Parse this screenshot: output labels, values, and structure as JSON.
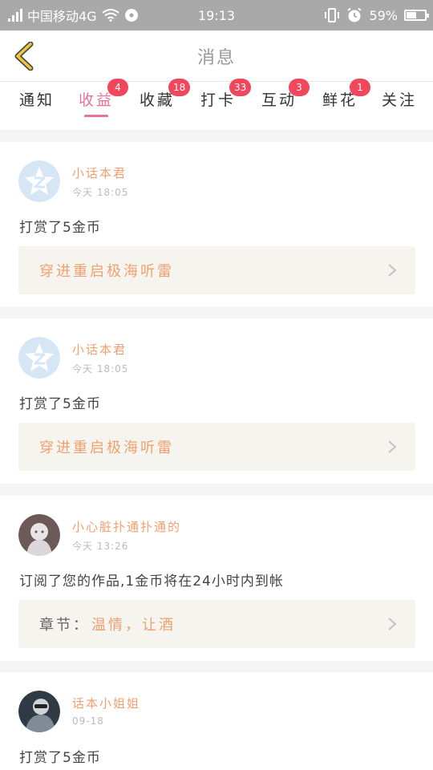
{
  "status_bar": {
    "carrier": "中国移动4G",
    "time": "19:13",
    "battery": "59%",
    "battery_level": 0.59
  },
  "header": {
    "title": "消息"
  },
  "tabs": [
    {
      "label": "通知",
      "badge": ""
    },
    {
      "label": "收益",
      "badge": "4"
    },
    {
      "label": "收藏",
      "badge": "18"
    },
    {
      "label": "打卡",
      "badge": "33"
    },
    {
      "label": "互动",
      "badge": "3"
    },
    {
      "label": "鲜花",
      "badge": "1"
    },
    {
      "label": "关注",
      "badge": ""
    }
  ],
  "messages": [
    {
      "name": "小话本君",
      "time": "今天 18:05",
      "text": "打赏了5金币",
      "box_prefix": "",
      "box_text": "穿进重启极海听雷",
      "avatar": "app-logo-avatar"
    },
    {
      "name": "小话本君",
      "time": "今天 18:05",
      "text": "打赏了5金币",
      "box_prefix": "",
      "box_text": "穿进重启极海听雷",
      "avatar": "app-logo-avatar"
    },
    {
      "name": "小心脏扑通扑通的",
      "time": "今天 13:26",
      "text": "订阅了您的作品,1金币将在24小时内到帐",
      "box_prefix": "章节：",
      "box_text": "温情，让酒",
      "avatar": "user-photo-avatar"
    },
    {
      "name": "话本小姐姐",
      "time": "09-18",
      "text": "打赏了5金币",
      "box_prefix": "",
      "box_text": "",
      "avatar": "user-photo-avatar"
    }
  ],
  "colors": {
    "accent": "#e8709a",
    "badge": "#f0475c",
    "name": "#f0a070",
    "statusbar": "#a9a9a9"
  }
}
